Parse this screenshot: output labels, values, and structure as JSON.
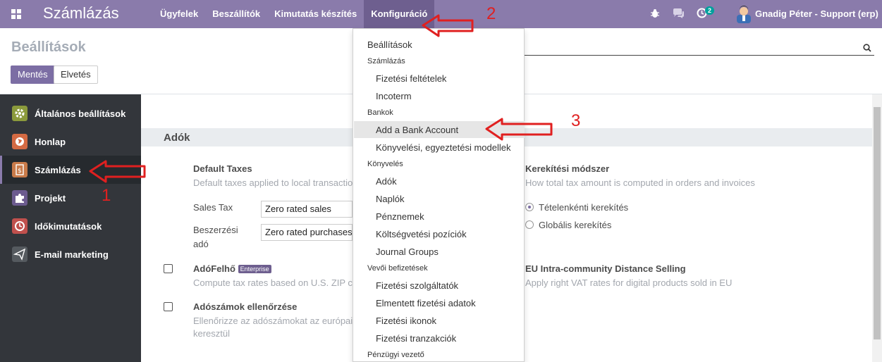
{
  "navbar": {
    "brand": "Számlázás",
    "menu": [
      {
        "label": "Ügyfelek"
      },
      {
        "label": "Beszállítók"
      },
      {
        "label": "Kimutatás készítés"
      },
      {
        "label": "Konfiguráció"
      }
    ],
    "activity_count": "2",
    "user_name": "Gnadig Péter - Support (erp)"
  },
  "control_panel": {
    "title": "Beállítások",
    "save_label": "Mentés",
    "discard_label": "Elvetés"
  },
  "sidebar": {
    "items": [
      {
        "label": "Általános beállítások",
        "icon": "gear-icon",
        "color": "#6b8e23"
      },
      {
        "label": "Honlap",
        "icon": "globe-icon",
        "color": "#d46a43"
      },
      {
        "label": "Számlázás",
        "icon": "invoice-icon",
        "color": "#c97b4a"
      },
      {
        "label": "Projekt",
        "icon": "puzzle-icon",
        "color": "#6c5b8f"
      },
      {
        "label": "Időkimutatások",
        "icon": "clock-icon",
        "color": "#c0504d"
      },
      {
        "label": "E-mail marketing",
        "icon": "paper-plane-icon",
        "color": "#555a5f"
      }
    ]
  },
  "content": {
    "section_title": "Adók",
    "default_taxes": {
      "title": "Default Taxes",
      "description": "Default taxes applied to local transactio",
      "sales_tax_label": "Sales Tax",
      "sales_tax_value": "Zero rated sales",
      "purchase_tax_label_1": "Beszerzési",
      "purchase_tax_label_2": "adó",
      "purchase_tax_value": "Zero rated purchases"
    },
    "rounding": {
      "title": "Kerekítési módszer",
      "description": "How total tax amount is computed in orders and invoices",
      "option_line": "Tételenkénti kerekítés",
      "option_global": "Globális kerekítés"
    },
    "taxcloud": {
      "title": "AdóFelhő",
      "badge": "Enterprise",
      "description": "Compute tax rates based on U.S. ZIP c"
    },
    "eu_distance": {
      "title": "EU Intra-community Distance Selling",
      "description": "Apply right VAT rates for digital products sold in EU"
    },
    "vat_check": {
      "title": "Adószámok ellenőrzése",
      "description_1": "Ellenőrizze az adószámokat az európai",
      "description_2": "keresztül"
    }
  },
  "dropdown": {
    "settings": "Beállítások",
    "h_invoicing": "Számlázás",
    "payment_terms": "Fizetési feltételek",
    "incoterm": "Incoterm",
    "h_banks": "Bankok",
    "add_bank": "Add a Bank Account",
    "reconciliation_models": "Könyvelési, egyeztetési modellek",
    "h_accounting": "Könyvelés",
    "taxes": "Adók",
    "journals": "Naplók",
    "currencies": "Pénznemek",
    "budgetary_positions": "Költségvetési pozíciók",
    "journal_groups": "Journal Groups",
    "h_online_payments": "Vevői befizetések",
    "payment_acquirers": "Fizetési szolgáltatók",
    "saved_payment_data": "Elmentett fizetési adatok",
    "payment_icons": "Fizetési ikonok",
    "payment_transactions": "Fizetési tranzakciók",
    "h_management": "Pénzügyi vezető"
  },
  "annotations": {
    "n1": "1",
    "n2": "2",
    "n3": "3",
    "color": "#e02020"
  }
}
